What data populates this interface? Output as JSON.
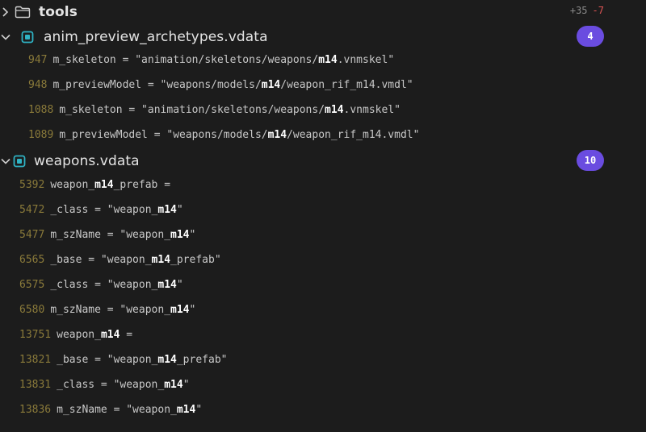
{
  "folder": {
    "name": "tools",
    "added": "+35",
    "removed": "-7"
  },
  "files": [
    {
      "name": "anim_preview_archetypes.vdata",
      "count": "4",
      "lines": [
        {
          "num": "947",
          "pre": "m_skeleton = \"animation/skeletons/weapons/",
          "match": "m14",
          "post": ".vnmskel\""
        },
        {
          "num": "948",
          "pre": "m_previewModel = \"weapons/models/",
          "match": "m14",
          "post": "/weapon_rif_m14.vmdl\""
        },
        {
          "num": "1088",
          "pre": "m_skeleton = \"animation/skeletons/weapons/",
          "match": "m14",
          "post": ".vnmskel\""
        },
        {
          "num": "1089",
          "pre": "m_previewModel = \"weapons/models/",
          "match": "m14",
          "post": "/weapon_rif_m14.vmdl\""
        }
      ]
    },
    {
      "name": "weapons.vdata",
      "count": "10",
      "lines": [
        {
          "num": "5392",
          "pre": "weapon_",
          "match": "m14",
          "post": "_prefab ="
        },
        {
          "num": "5472",
          "pre": "_class = \"weapon_",
          "match": "m14",
          "post": "\""
        },
        {
          "num": "5477",
          "pre": "m_szName = \"weapon_",
          "match": "m14",
          "post": "\""
        },
        {
          "num": "6565",
          "pre": "_base = \"weapon_",
          "match": "m14",
          "post": "_prefab\""
        },
        {
          "num": "6575",
          "pre": "_class = \"weapon_",
          "match": "m14",
          "post": "\""
        },
        {
          "num": "6580",
          "pre": "m_szName = \"weapon_",
          "match": "m14",
          "post": "\""
        },
        {
          "num": "13751",
          "pre": "weapon_",
          "match": "m14",
          "post": " ="
        },
        {
          "num": "13821",
          "pre": "_base = \"weapon_",
          "match": "m14",
          "post": "_prefab\""
        },
        {
          "num": "13831",
          "pre": "_class = \"weapon_",
          "match": "m14",
          "post": "\""
        },
        {
          "num": "13836",
          "pre": "m_szName = \"weapon_",
          "match": "m14",
          "post": "\""
        }
      ]
    }
  ],
  "icons": {
    "folder": "folder-icon",
    "chevron": "chevron-down-icon",
    "file": "file-icon"
  },
  "colors": {
    "background": "#1c1c1c",
    "badge": "#6a4ce0",
    "file_icon": "#2fb3c4",
    "line_number": "#8a7a3a",
    "removed": "#e05555"
  }
}
